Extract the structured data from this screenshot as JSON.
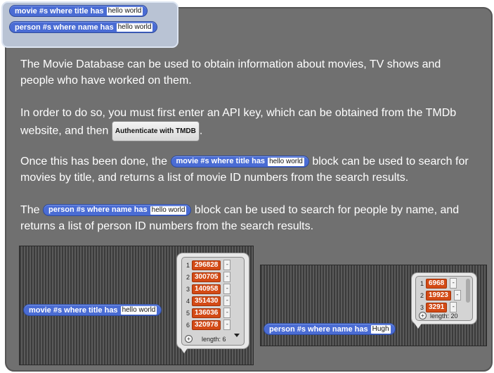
{
  "palette": {
    "movie_block": {
      "text": "movie #s where title has",
      "value": "hello world"
    },
    "person_block": {
      "text": "person #s where name has",
      "value": "hello world"
    }
  },
  "paragraphs": {
    "p1": "The Movie Database can be used to obtain information about movies, TV shows and people who have worked on them.",
    "p2a": "In order to do so, you must first enter an API key, which can be obtained from the TMDb website, and then",
    "p2_button": "Authenticate with TMDB",
    "p2b": ".",
    "p3a": "Once this has been done, the",
    "p3b": "block can be used to search for movies by title, and returns a list of movie ID numbers from the search results.",
    "p4a": "The",
    "p4b": "block can be used to search for people by name, and returns a list of person ID numbers from the search results."
  },
  "inline_blocks": {
    "movie": {
      "text": "movie #s where title has",
      "value": "hello world"
    },
    "person": {
      "text": "person #s where name has",
      "value": "hello world"
    }
  },
  "demo_movie": {
    "block": {
      "text": "movie #s where title has",
      "value": "hello world"
    },
    "indices": [
      "1",
      "2",
      "3",
      "4",
      "5",
      "6"
    ],
    "results": [
      "296828",
      "300705",
      "140958",
      "351430",
      "136036",
      "320978"
    ],
    "minus": "-",
    "plus": "+",
    "length_label": "length: 6"
  },
  "demo_person": {
    "block": {
      "text": "person #s where name has",
      "value": "Hugh"
    },
    "indices": [
      "1",
      "2",
      "3"
    ],
    "results": [
      "6968",
      "19923",
      "3291"
    ],
    "minus": "-",
    "plus": "+",
    "length_label": "length: 20"
  }
}
